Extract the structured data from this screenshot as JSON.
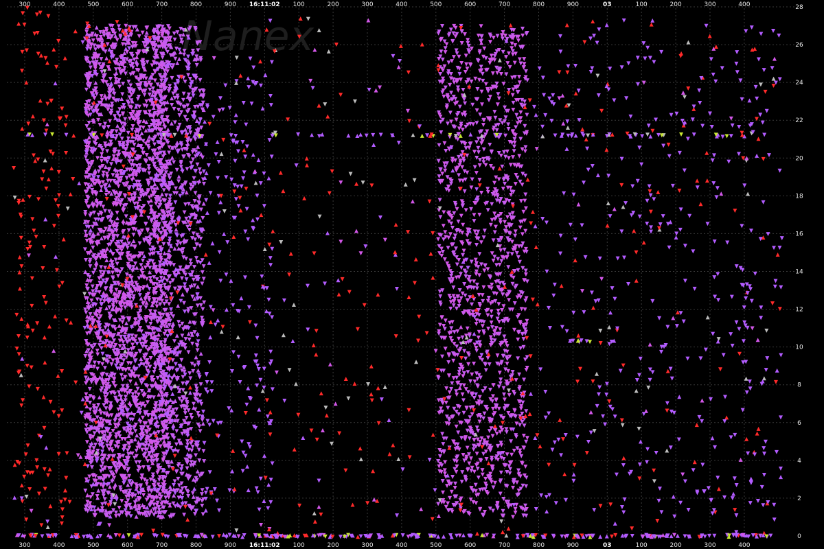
{
  "chart_data": {
    "type": "scatter",
    "watermark": "Nanex",
    "top_axis_labels": [
      "300",
      "400",
      "500",
      "600",
      "700",
      "800",
      "900",
      "16:11:02",
      "100",
      "200",
      "300",
      "400",
      "500",
      "600",
      "700",
      "800",
      "900",
      "03",
      "100",
      "200",
      "300",
      "400"
    ],
    "bottom_axis_labels": [
      "300",
      "400",
      "500",
      "600",
      "700",
      "800",
      "900",
      "16:11:02",
      "100",
      "200",
      "300",
      "400",
      "500",
      "600",
      "700",
      "800",
      "900",
      "03",
      "100",
      "200",
      "300",
      "400"
    ],
    "bold_axis_labels": [
      "16:11:02",
      "03"
    ],
    "y_tick_labels": [
      "0",
      "2",
      "4",
      "6",
      "8",
      "10",
      "12",
      "14",
      "16",
      "18",
      "20",
      "22",
      "24",
      "26",
      "28"
    ],
    "ylim": [
      0,
      28
    ],
    "grid": true,
    "background": "#000000",
    "series_colors": [
      "#d257e8",
      "#b35cff",
      "#ff2a2a",
      "#bdbdbd",
      "#c8e632",
      "#ff9a2a",
      "#30d0c0"
    ],
    "clusters": [
      {
        "color": "#c65cf0",
        "x_start": "500",
        "x_end": "700",
        "y_range": [
          1,
          27
        ],
        "density": "very high"
      },
      {
        "color": "#c65cf0",
        "x_start": "700",
        "x_end": "800",
        "y_range": [
          1,
          27
        ],
        "density": "high"
      },
      {
        "color": "#b35cff",
        "x_start": "850",
        "x_end": "16:11:02",
        "y_range": [
          1,
          26
        ],
        "density": "medium"
      },
      {
        "color": "#d257e8",
        "x_start": "500",
        "x_end": "700",
        "y_range": [
          1,
          27
        ],
        "density": "high"
      },
      {
        "color": "#ff2a2a",
        "x_start": "300",
        "x_end": "400",
        "y_range": [
          0,
          28
        ],
        "density": "sparse"
      }
    ],
    "notable_bands": [
      {
        "y": 21.2,
        "colors": [
          "#c8e632",
          "#ff2a2a",
          "#bdbdbd"
        ]
      },
      {
        "y": 10.3,
        "colors": [
          "#c8e632",
          "#bdbdbd"
        ]
      },
      {
        "y": 0,
        "colors": [
          "#d257e8",
          "#c8e632",
          "#ff2a2a"
        ]
      }
    ]
  }
}
